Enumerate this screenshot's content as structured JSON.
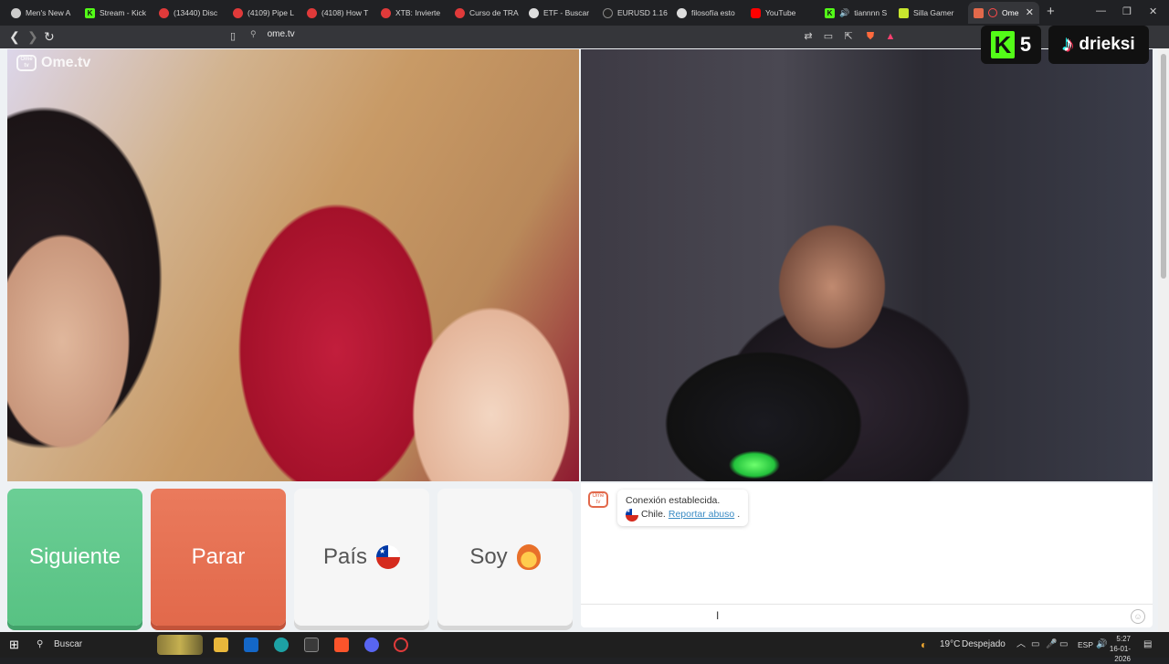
{
  "browser": {
    "tabs": [
      {
        "title": "Men's New A",
        "color": "#cccccc"
      },
      {
        "title": "Stream - Kick",
        "color": "#53fc18"
      },
      {
        "title": "(13440) Disc",
        "color": "#e03a3a"
      },
      {
        "title": "(4109) Pipe L",
        "color": "#e03a3a"
      },
      {
        "title": "(4108) How T",
        "color": "#e03a3a"
      },
      {
        "title": "XTB: Invierte",
        "color": "#e03a3a"
      },
      {
        "title": "Curso de TRA",
        "color": "#e03a3a"
      },
      {
        "title": "ETF - Buscar",
        "color": "#dddddd"
      },
      {
        "title": "EURUSD 1.16",
        "color": "#222222"
      },
      {
        "title": "filosofía esto",
        "color": "#dddddd"
      },
      {
        "title": "YouTube",
        "color": "#ff0000"
      },
      {
        "title": "tiannnn S",
        "color": "#53fc18"
      },
      {
        "title": "Silla Gamer",
        "color": "#c8e62e"
      },
      {
        "title": "Ome",
        "color": "#e2694b"
      }
    ],
    "url": "ome.tv"
  },
  "page": {
    "watermark": "Ome.tv",
    "tv_icon_text": "Ome tv",
    "overlays": {
      "kick_letter": "K",
      "kick_count": "5",
      "tiktok_name": "drieksi"
    },
    "buttons": {
      "next": "Siguiente",
      "stop": "Parar",
      "country": "País",
      "gender": "Soy"
    },
    "chat": {
      "status": "Conexión establecida.",
      "country": "Chile.",
      "report_link": "Reportar abuso",
      "period": "."
    }
  },
  "taskbar": {
    "search_placeholder": "Buscar",
    "weather_temp": "19°C",
    "weather_desc": "Despejado",
    "language": "ESP",
    "time": "5:27",
    "date": "16-01-2026"
  }
}
